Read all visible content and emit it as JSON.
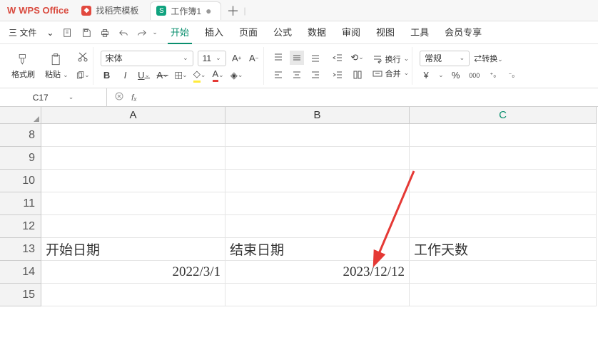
{
  "titlebar": {
    "app_name": "WPS Office",
    "template_tab": "找稻壳模板",
    "workbook_tab": "工作簿1",
    "plus": "＋",
    "bar": "|"
  },
  "menubar": {
    "file": "三 文件",
    "tabs": [
      "开始",
      "插入",
      "页面",
      "公式",
      "数据",
      "审阅",
      "视图",
      "工具",
      "会员专享"
    ],
    "active_tab_index": 0
  },
  "ribbon": {
    "format_brush": "格式刷",
    "paste": "粘贴",
    "font_name": "宋体",
    "font_size": "11",
    "wrap": "换行",
    "merge": "合并",
    "numfmt": "常规",
    "convert": "转换",
    "currency": "¥",
    "percent": "%",
    "thousand": "000",
    "dec_inc": ".0",
    "dec_dec": ".00"
  },
  "fx": {
    "namebox": "C17",
    "fx_label": "fₓ"
  },
  "columns": [
    "A",
    "B",
    "C"
  ],
  "rows": [
    "8",
    "9",
    "10",
    "11",
    "12",
    "13",
    "14",
    "15"
  ],
  "cells": {
    "A13": "开始日期",
    "B13": "结束日期",
    "C13": "工作天数",
    "A14": "2022/3/1",
    "B14": "2023/12/12"
  },
  "chart_data": {
    "type": "table",
    "title": "",
    "columns": [
      "开始日期",
      "结束日期",
      "工作天数"
    ],
    "rows": [
      [
        "2022/3/1",
        "2023/12/12",
        ""
      ]
    ]
  }
}
